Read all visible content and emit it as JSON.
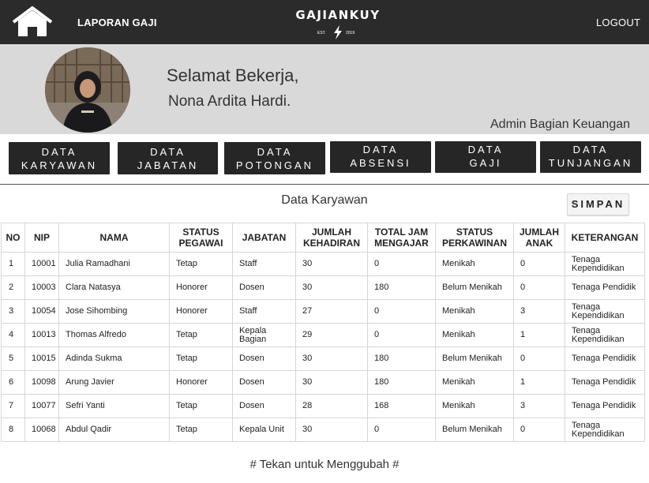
{
  "nav": {
    "laporan_label": "LAPORAN GAJI",
    "logout_label": "LOGOUT",
    "logo_text": "GAJIANKUY",
    "logo_est": "EST.",
    "logo_year": "2019"
  },
  "greeting": {
    "line1": "Selamat Bekerja,",
    "line2": "Nona Ardita Hardi.",
    "role": "Admin Bagian Keuangan"
  },
  "menu": [
    {
      "line1": "DATA",
      "line2": "KARYAWAN"
    },
    {
      "line1": "DATA",
      "line2": "JABATAN"
    },
    {
      "line1": "DATA",
      "line2": "POTONGAN"
    },
    {
      "line1": "DATA",
      "line2": "ABSENSI"
    },
    {
      "line1": "DATA",
      "line2": "GAJI"
    },
    {
      "line1": "DATA",
      "line2": "TUNJANGAN"
    }
  ],
  "section": {
    "title": "Data Karyawan",
    "save_label": "SIMPAN"
  },
  "table": {
    "headers": [
      "NO",
      "NIP",
      "NAMA",
      "STATUS PEGAWAI",
      "JABATAN",
      "JUMLAH KEHADIRAN",
      "TOTAL JAM MENGAJAR",
      "STATUS PERKAWINAN",
      "JUMLAH ANAK",
      "KETERANGAN"
    ],
    "rows": [
      [
        "1",
        "10001",
        "Julia Ramadhani",
        "Tetap",
        "Staff",
        "30",
        "0",
        "Menikah",
        "0",
        "Tenaga Kependidikan"
      ],
      [
        "2",
        "10003",
        "Clara Natasya",
        "Honorer",
        "Dosen",
        "30",
        "180",
        "Belum Menikah",
        "0",
        "Tenaga Pendidik"
      ],
      [
        "3",
        "10054",
        "Jose Sihombing",
        "Honorer",
        "Staff",
        "27",
        "0",
        "Menikah",
        "3",
        "Tenaga Kependidikan"
      ],
      [
        "4",
        "10013",
        "Thomas Alfredo",
        "Tetap",
        "Kepala Bagian",
        "29",
        "0",
        "Menikah",
        "1",
        "Tenaga Kependidikan"
      ],
      [
        "5",
        "10015",
        "Adinda Sukma",
        "Tetap",
        "Dosen",
        "30",
        "180",
        "Belum Menikah",
        "0",
        "Tenaga Pendidik"
      ],
      [
        "6",
        "10098",
        "Arung Javier",
        "Honorer",
        "Dosen",
        "30",
        "180",
        "Menikah",
        "1",
        "Tenaga Pendidik"
      ],
      [
        "7",
        "10077",
        "Sefri Yanti",
        "Tetap",
        "Dosen",
        "28",
        "168",
        "Menikah",
        "3",
        "Tenaga Pendidik"
      ],
      [
        "8",
        "10068",
        "Abdul Qadir",
        "Tetap",
        "Kepala Unit",
        "30",
        "0",
        "Belum Menikah",
        "0",
        "Tenaga Kependidikan"
      ]
    ]
  },
  "footer": {
    "note": "# Tekan untuk Menggubah #"
  },
  "colors": {
    "navbar": "#2b2b2b",
    "greeting_band": "#d9d9d9",
    "menu_button": "#262626"
  }
}
